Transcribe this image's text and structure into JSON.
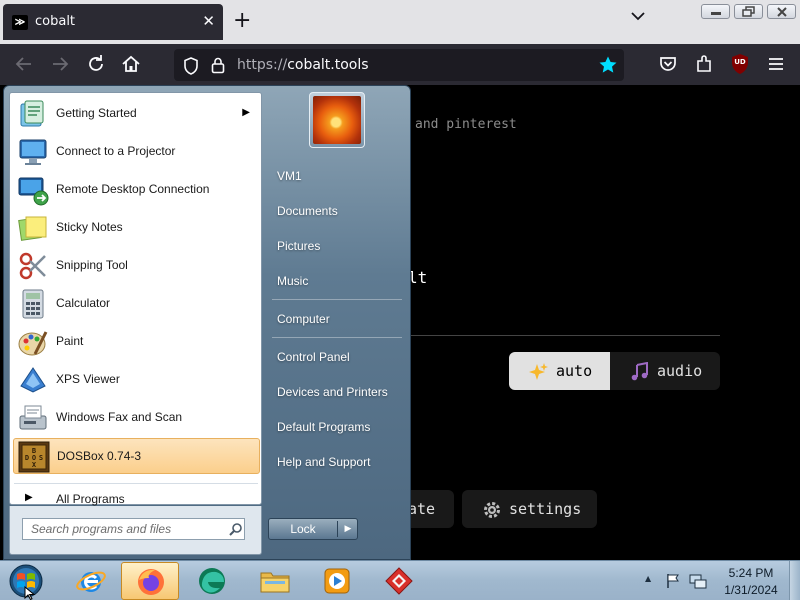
{
  "browser": {
    "tab_title": "cobalt",
    "favicon_text": "≫",
    "tab_close": "✕",
    "new_tab": "+",
    "url_scheme": "https://",
    "url_host": "cobalt.tools",
    "toolbar_icons": [
      "back-arrow-icon",
      "forward-arrow-icon",
      "reload-icon",
      "home-icon",
      "pocket-icon",
      "extensions-icon",
      "ublock-icon",
      "menu-icon"
    ],
    "ublock_badge": "UD",
    "accent": "#00ddff"
  },
  "page": {
    "subtext": "and pinterest",
    "logo_fragment": "lt",
    "mode_auto": "auto",
    "mode_audio": "audio",
    "update_fragment": "ate",
    "settings_label": "settings"
  },
  "start_menu": {
    "programs": [
      {
        "label": "Getting Started",
        "icon": "getting-started-icon",
        "submenu": true
      },
      {
        "label": "Connect to a Projector",
        "icon": "projector-icon"
      },
      {
        "label": "Remote Desktop Connection",
        "icon": "remote-desktop-icon"
      },
      {
        "label": "Sticky Notes",
        "icon": "sticky-notes-icon"
      },
      {
        "label": "Snipping Tool",
        "icon": "snipping-tool-icon"
      },
      {
        "label": "Calculator",
        "icon": "calculator-icon"
      },
      {
        "label": "Paint",
        "icon": "paint-icon"
      },
      {
        "label": "XPS Viewer",
        "icon": "xps-viewer-icon"
      },
      {
        "label": "Windows Fax and Scan",
        "icon": "fax-scan-icon"
      },
      {
        "label": "DOSBox 0.74-3",
        "icon": "dosbox-icon",
        "highlighted": true
      }
    ],
    "all_programs": "All Programs",
    "search_placeholder": "Search programs and files",
    "places": [
      "VM1",
      "Documents",
      "Pictures",
      "Music",
      "Computer",
      "Control Panel",
      "Devices and Printers",
      "Default Programs",
      "Help and Support"
    ],
    "lock_label": "Lock",
    "lock_arrow": "▶"
  },
  "taskbar": {
    "pinned": [
      "internet-explorer-icon",
      "firefox-icon",
      "edge-icon",
      "file-explorer-icon",
      "media-player-icon",
      "app-icon"
    ],
    "time": "5:24 PM",
    "date": "1/31/2024"
  }
}
